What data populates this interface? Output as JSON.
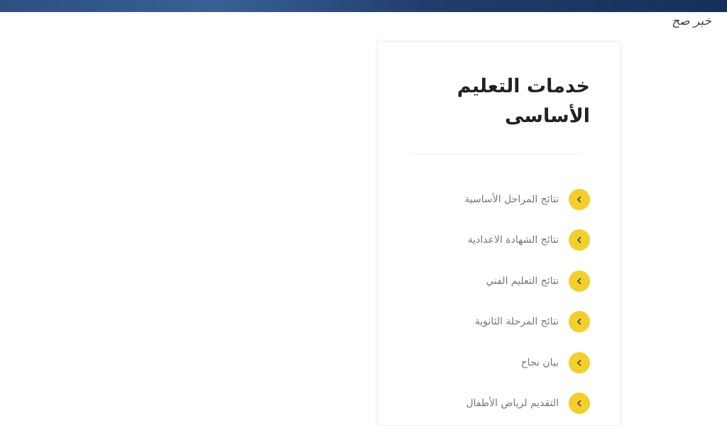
{
  "watermark": "خبر صح",
  "card": {
    "title": "خدمات التعليم الأساسى",
    "items": [
      {
        "label": "نتائج المراحل الأساسية",
        "icon": "chevron-left-icon"
      },
      {
        "label": "نتائج الشهادة الاعدادية",
        "icon": "chevron-left-icon"
      },
      {
        "label": "نتائج التعليم الفني",
        "icon": "chevron-left-icon"
      },
      {
        "label": "نتائج المرحلة الثانوية",
        "icon": "chevron-left-icon"
      },
      {
        "label": "بيان نجاح",
        "icon": "chevron-left-icon"
      },
      {
        "label": "التقديم لرياض الأطفال",
        "icon": "chevron-left-icon"
      }
    ]
  },
  "colors": {
    "accent": "#f2cf2b",
    "header_bar": "#2e4f82",
    "title": "#222222",
    "label": "#777777"
  }
}
